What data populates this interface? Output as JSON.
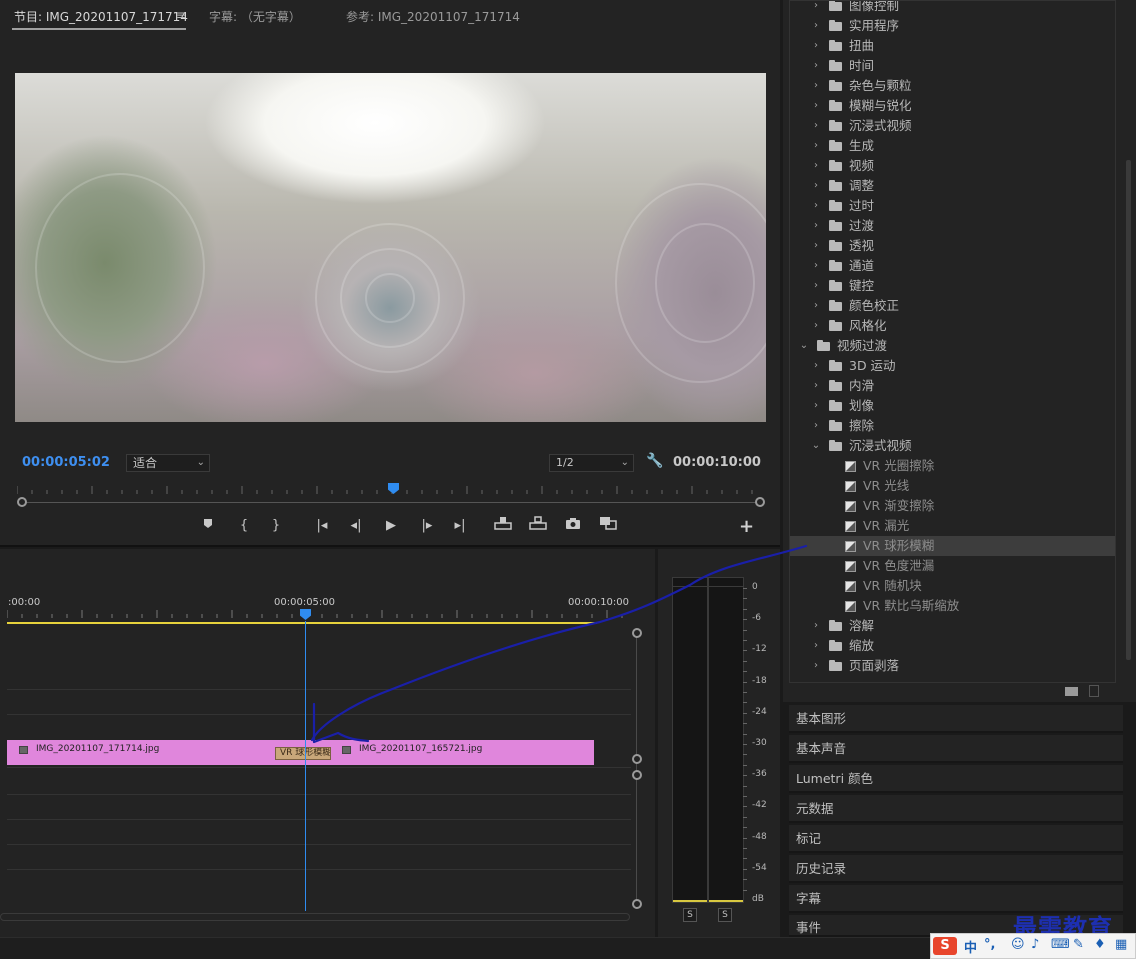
{
  "monitor": {
    "tabs": [
      {
        "label": "节目: IMG_20201107_171714"
      },
      {
        "label": "字幕: （无字幕）"
      },
      {
        "label": "参考: IMG_20201107_171714"
      }
    ],
    "menu_icon": "≡",
    "current_time": "00:00:05:02",
    "fit_value": "适合",
    "resolution_value": "1/2",
    "duration": "00:00:10:00",
    "transport_icons": [
      "marker-icon",
      "mark-in-icon",
      "mark-out-icon",
      "go-to-in-icon",
      "step-back-icon",
      "play-icon",
      "step-forward-icon",
      "go-to-out-icon",
      "lift-icon",
      "extract-icon",
      "export-frame-icon",
      "compare-icon"
    ],
    "add_label": "+"
  },
  "effects": {
    "items": [
      {
        "label": "图像控制",
        "kind": "folder",
        "level": 1
      },
      {
        "label": "实用程序",
        "kind": "folder",
        "level": 1
      },
      {
        "label": "扭曲",
        "kind": "folder",
        "level": 1
      },
      {
        "label": "时间",
        "kind": "folder",
        "level": 1
      },
      {
        "label": "杂色与颗粒",
        "kind": "folder",
        "level": 1
      },
      {
        "label": "模糊与锐化",
        "kind": "folder",
        "level": 1
      },
      {
        "label": "沉浸式视频",
        "kind": "folder",
        "level": 1
      },
      {
        "label": "生成",
        "kind": "folder",
        "level": 1
      },
      {
        "label": "视频",
        "kind": "folder",
        "level": 1
      },
      {
        "label": "调整",
        "kind": "folder",
        "level": 1
      },
      {
        "label": "过时",
        "kind": "folder",
        "level": 1
      },
      {
        "label": "过渡",
        "kind": "folder",
        "level": 1
      },
      {
        "label": "透视",
        "kind": "folder",
        "level": 1
      },
      {
        "label": "通道",
        "kind": "folder",
        "level": 1
      },
      {
        "label": "键控",
        "kind": "folder",
        "level": 1
      },
      {
        "label": "颜色校正",
        "kind": "folder",
        "level": 1
      },
      {
        "label": "风格化",
        "kind": "folder",
        "level": 1
      },
      {
        "label": "视频过渡",
        "kind": "folder-open",
        "level": 0
      },
      {
        "label": "3D 运动",
        "kind": "folder",
        "level": 1
      },
      {
        "label": "内滑",
        "kind": "folder",
        "level": 1
      },
      {
        "label": "划像",
        "kind": "folder",
        "level": 1
      },
      {
        "label": "擦除",
        "kind": "folder",
        "level": 1
      },
      {
        "label": "沉浸式视频",
        "kind": "folder-open",
        "level": 1
      },
      {
        "label": "VR 光圈擦除",
        "kind": "effect",
        "level": 2
      },
      {
        "label": "VR 光线",
        "kind": "effect",
        "level": 2
      },
      {
        "label": "VR 渐变擦除",
        "kind": "effect",
        "level": 2
      },
      {
        "label": "VR 漏光",
        "kind": "effect",
        "level": 2
      },
      {
        "label": "VR 球形模糊",
        "kind": "effect",
        "level": 2,
        "selected": true
      },
      {
        "label": "VR 色度泄漏",
        "kind": "effect",
        "level": 2
      },
      {
        "label": "VR 随机块",
        "kind": "effect",
        "level": 2
      },
      {
        "label": "VR 默比乌斯缩放",
        "kind": "effect",
        "level": 2
      },
      {
        "label": "溶解",
        "kind": "folder",
        "level": 1
      },
      {
        "label": "缩放",
        "kind": "folder",
        "level": 1
      },
      {
        "label": "页面剥落",
        "kind": "folder",
        "level": 1
      }
    ]
  },
  "panels": [
    "基本图形",
    "基本声音",
    "Lumetri 颜色",
    "元数据",
    "标记",
    "历史记录",
    "字幕",
    "事件"
  ],
  "timeline": {
    "timecodes": [
      ":00:00",
      "00:00:05:00",
      "00:00:10:00"
    ],
    "clip_a": "IMG_20201107_171714.jpg",
    "clip_b": "IMG_20201107_165721.jpg",
    "transition": "VR 球形模糊"
  },
  "audio_meter": {
    "db_labels": [
      "0",
      "-6",
      "-12",
      "-18",
      "-24",
      "-30",
      "-36",
      "-42",
      "-48",
      "-54",
      "dB"
    ],
    "solo_label": "S"
  },
  "ime": {
    "logo": "S",
    "lang": "中",
    "punct": "°,"
  },
  "watermark": "最需教育",
  "colors": {
    "accent": "#2f8cf0",
    "clip": "#e086dc",
    "transition": "#c9a77a",
    "work_area": "#e6d23c",
    "annotation": "#1a1fa8"
  }
}
